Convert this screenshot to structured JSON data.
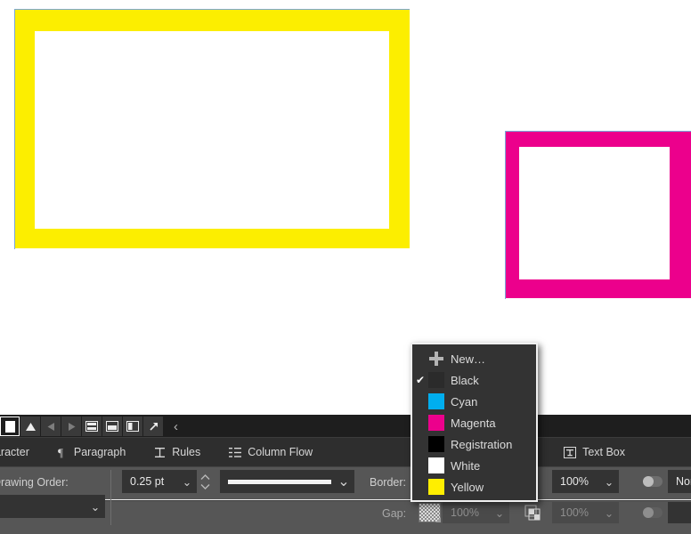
{
  "canvas": {
    "objects": [
      {
        "name": "yellow-frame",
        "fill_color": "#fcee00",
        "selection_color": "#7aa7d8"
      },
      {
        "name": "magenta-frame",
        "fill_color": "#ec008c",
        "selection_color": "#7aa7d8"
      }
    ]
  },
  "control_strip": {
    "buttons": [
      {
        "name": "page-selector",
        "icon": "page-icon",
        "state": "selected"
      },
      {
        "name": "master-page",
        "icon": "triangle-up-icon",
        "state": "normal"
      },
      {
        "name": "previous-page",
        "icon": "triangle-left-icon",
        "state": "disabled"
      },
      {
        "name": "next-page",
        "icon": "triangle-right-icon",
        "state": "disabled"
      },
      {
        "name": "split-horizontal",
        "icon": "split-horizontal-icon",
        "state": "normal"
      },
      {
        "name": "split-top",
        "icon": "split-top-icon",
        "state": "normal"
      },
      {
        "name": "split-vertical",
        "icon": "split-vertical-icon",
        "state": "normal"
      },
      {
        "name": "expand-view",
        "icon": "arrow-diagonal-icon",
        "state": "normal"
      }
    ],
    "collapse_glyph": "‹"
  },
  "tabs": [
    {
      "label": "Character",
      "icon": null
    },
    {
      "label": "Paragraph",
      "icon": "pilcrow-icon"
    },
    {
      "label": "Rules",
      "icon": "rules-icon"
    },
    {
      "label": "Column Flow",
      "icon": "column-flow-icon"
    },
    {
      "label": "Text Box",
      "icon": "text-box-icon"
    }
  ],
  "properties": {
    "drawing_order_label": "Drawing Order:",
    "drawing_order_value": "",
    "stroke_width_value": "0.25 pt",
    "stroke_style_value": "solid-line",
    "border_label": "Border:",
    "border_color": "#ffee00",
    "border_opacity": "100%",
    "border_blend_mode": "Normal",
    "gap_label": "Gap:",
    "gap_color": "none-checker",
    "gap_opacity": "100%",
    "gap_shade": "100%",
    "chevron_glyph": "⌄"
  },
  "color_menu": {
    "items": [
      {
        "label": "New…",
        "swatch": null,
        "checked": false,
        "is_new": true
      },
      {
        "label": "Black",
        "swatch": "#2b2b2b",
        "checked": true,
        "is_new": false
      },
      {
        "label": "Cyan",
        "swatch": "#00aeef",
        "checked": false,
        "is_new": false
      },
      {
        "label": "Magenta",
        "swatch": "#ec008c",
        "checked": false,
        "is_new": false
      },
      {
        "label": "Registration",
        "swatch": "#000000",
        "checked": false,
        "is_new": false
      },
      {
        "label": "White",
        "swatch": "#ffffff",
        "checked": false,
        "is_new": false
      },
      {
        "label": "Yellow",
        "swatch": "#ffee00",
        "checked": false,
        "is_new": false
      }
    ],
    "check_glyph": "✔"
  }
}
